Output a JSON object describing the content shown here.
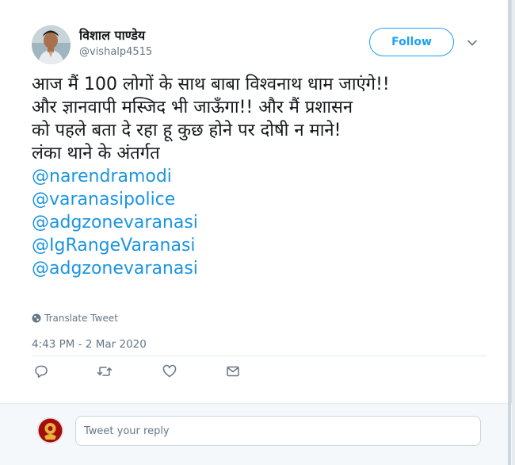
{
  "user": {
    "display_name": "विशाल पाण्डेय",
    "handle": "@vishalp4515"
  },
  "follow_label": "Follow",
  "tweet": {
    "lines": [
      "आज मैं 100 लोगों के साथ बाबा विश्वनाथ धाम जाएंगे!!",
      "और ज्ञानवापी मस्जिद भी जाऊँगा!! और मैं प्रशासन",
      "को पहले बता दे रहा हू कुछ होने पर दोषी न माने!",
      "लंका थाने के अंतर्गत"
    ],
    "mentions": [
      "@narendramodi",
      "@varanasipolice",
      "@adgzonevaranasi",
      "@IgRangeVaranasi",
      "@adgzonevaranasi"
    ]
  },
  "translate_label": "Translate Tweet",
  "timestamp": "4:43 PM - 2 Mar 2020",
  "actions": [
    "reply-icon",
    "retweet-icon",
    "like-icon",
    "message-icon"
  ],
  "reply": {
    "placeholder": "Tweet your reply"
  },
  "colors": {
    "accent": "#1da1f2",
    "mention": "#1b95e0",
    "muted": "#657786"
  }
}
